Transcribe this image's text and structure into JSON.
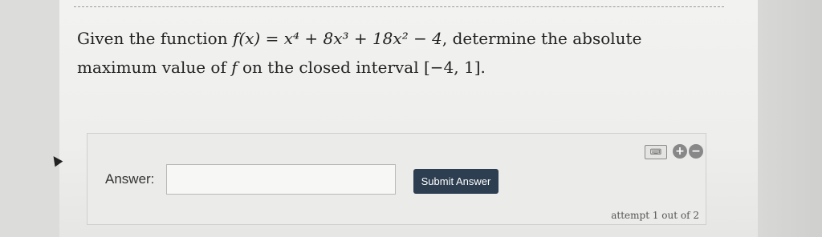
{
  "question": {
    "line1_prefix": "Given the function ",
    "function_expr": "f(x) = x⁴ + 8x³ + 18x² − 4",
    "line1_suffix": ", determine the absolute",
    "line2_prefix": "maximum value of ",
    "line2_var": "f",
    "line2_mid": " on the closed interval ",
    "interval": "[−4, 1]",
    "line2_suffix": "."
  },
  "answer": {
    "label": "Answer:",
    "input_value": "",
    "submit_label": "Submit Answer",
    "attempt_text": "attempt 1 out of 2"
  },
  "icons": {
    "keyboard": "keyboard-icon",
    "plus_minus": "plus-minus-icon"
  },
  "colors": {
    "submit_bg": "#2c3e50",
    "page_bg": "#eeeeec"
  }
}
